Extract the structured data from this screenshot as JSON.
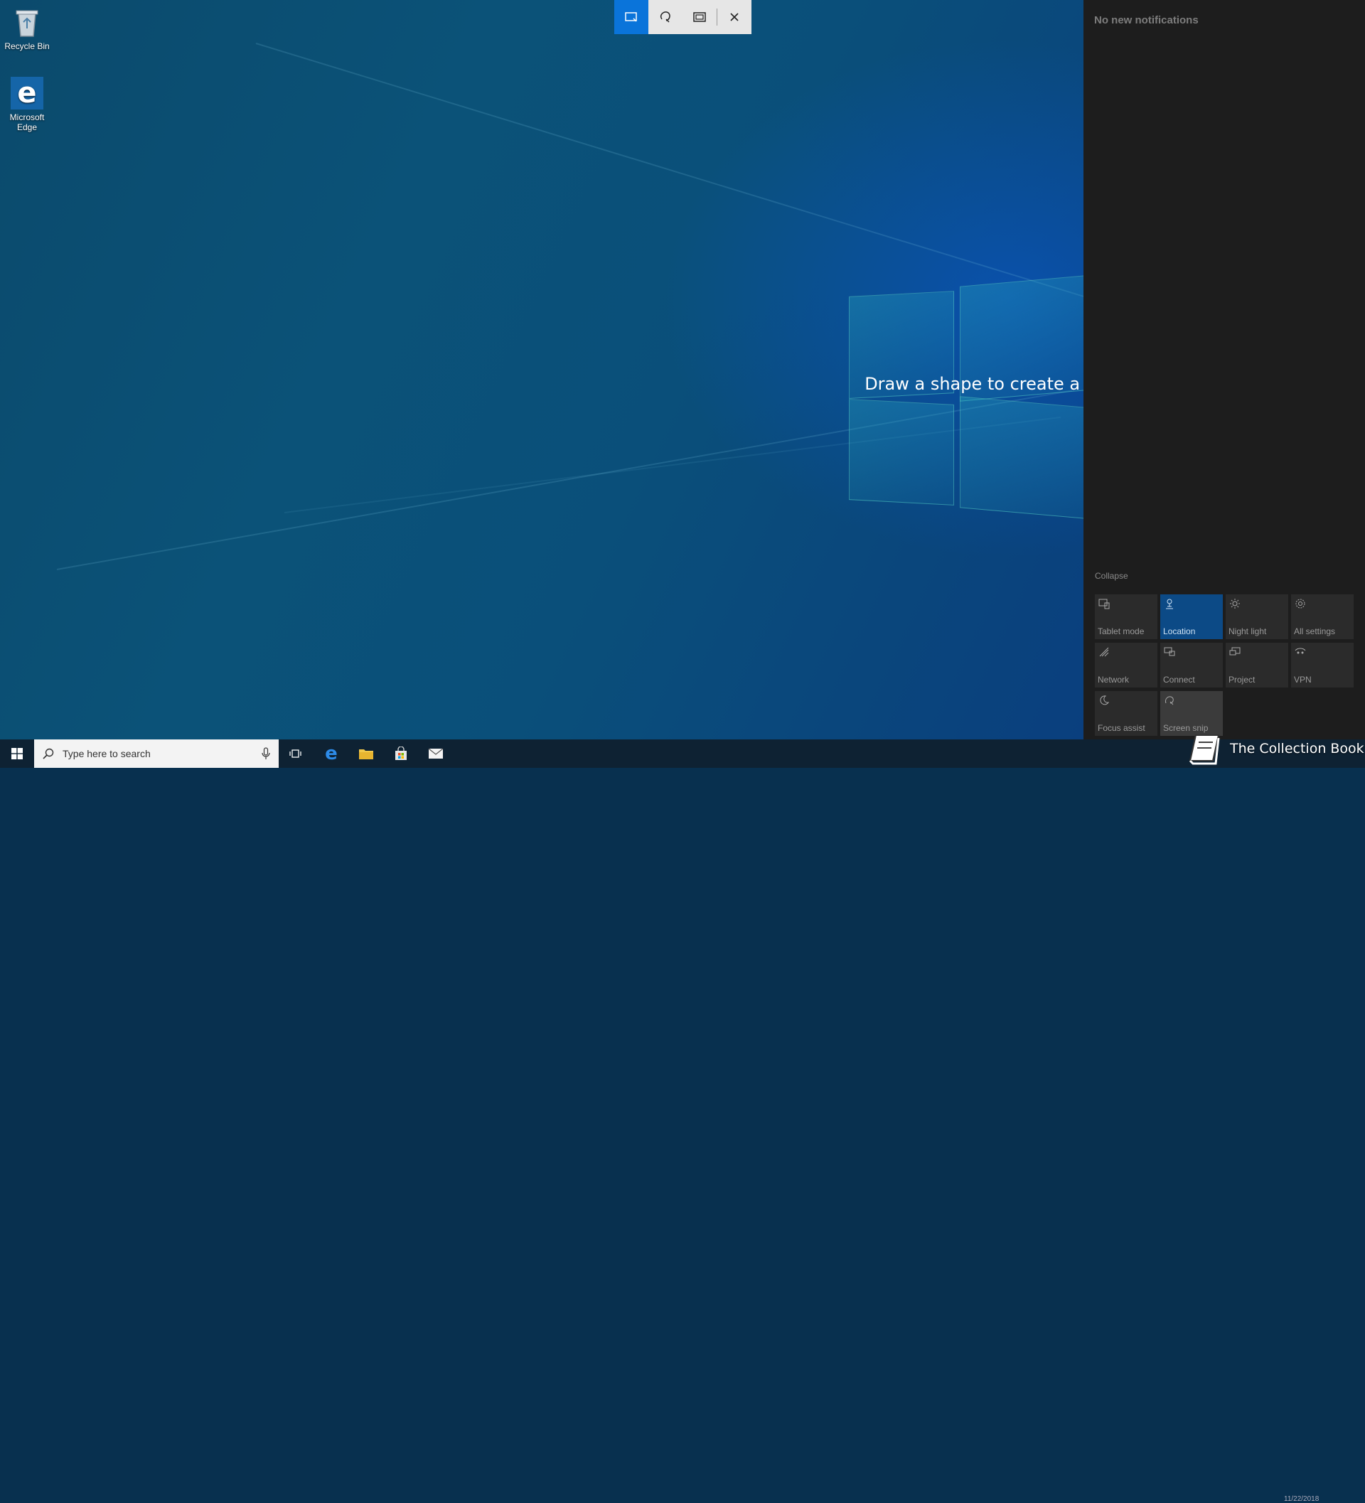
{
  "desktop": {
    "icons": [
      {
        "label": "Recycle Bin",
        "icon": "recycle-bin-icon"
      },
      {
        "label": "Microsoft Edge",
        "icon": "edge-icon"
      }
    ],
    "wallpaper": {
      "accent": "#0a5ad2",
      "pane_color": "#2aaabe"
    }
  },
  "snip_toolbar": {
    "modes": [
      {
        "name": "Rectangular snip",
        "icon": "rectangle-snip-icon",
        "active": true
      },
      {
        "name": "Freeform snip",
        "icon": "freeform-snip-icon",
        "active": false
      },
      {
        "name": "Fullscreen snip",
        "icon": "fullscreen-snip-icon",
        "active": false
      }
    ],
    "close_icon": "close-icon",
    "accent": "#0a74da"
  },
  "snip_hint": "Draw a shape to create a screen snip",
  "action_center": {
    "empty_text": "No new notifications",
    "collapse_label": "Collapse",
    "tiles": [
      {
        "label": "Tablet mode",
        "icon": "tablet-mode-icon",
        "state": "off"
      },
      {
        "label": "Location",
        "icon": "location-icon",
        "state": "on"
      },
      {
        "label": "Night light",
        "icon": "night-light-icon",
        "state": "off"
      },
      {
        "label": "All settings",
        "icon": "gear-icon",
        "state": "off"
      },
      {
        "label": "Network",
        "icon": "network-icon",
        "state": "off"
      },
      {
        "label": "Connect",
        "icon": "connect-icon",
        "state": "off"
      },
      {
        "label": "Project",
        "icon": "project-icon",
        "state": "off"
      },
      {
        "label": "VPN",
        "icon": "vpn-icon",
        "state": "off"
      },
      {
        "label": "Focus assist",
        "icon": "focus-assist-icon",
        "state": "off"
      },
      {
        "label": "Screen snip",
        "icon": "screen-snip-icon",
        "state": "hover"
      }
    ],
    "tile_on_color": "#0c4a86"
  },
  "taskbar": {
    "search_placeholder": "Type here to search",
    "pinned": [
      "task-view-icon",
      "edge-icon",
      "file-explorer-icon",
      "store-icon",
      "mail-icon"
    ],
    "tray_date": "11/22/2018"
  },
  "watermark": {
    "text": "The Collection Book"
  }
}
